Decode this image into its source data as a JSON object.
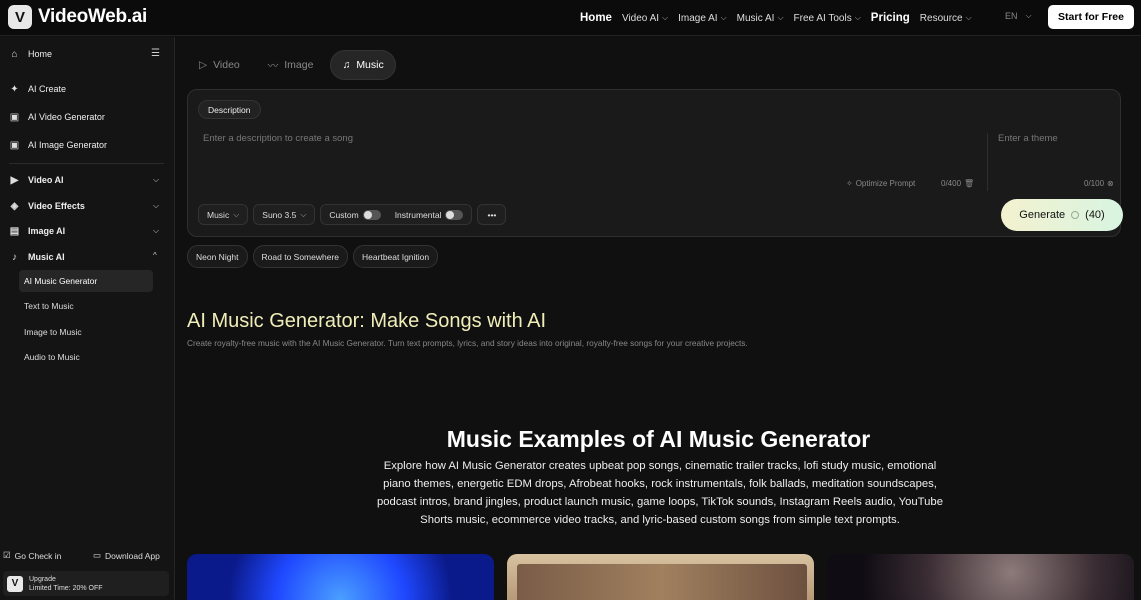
{
  "brand": {
    "name": "VideoWeb.ai",
    "mark": "V"
  },
  "nav": {
    "home": "Home",
    "video_ai": "Video AI",
    "image_ai": "Image AI",
    "music_ai": "Music AI",
    "free_ai_tools": "Free AI Tools",
    "pricing": "Pricing",
    "resource": "Resource",
    "lang": "EN",
    "cta": "Start for Free"
  },
  "sidebar": {
    "home": "Home",
    "ai_create": "AI Create",
    "ai_video_generator": "AI Video Generator",
    "ai_image_generator": "AI Image Generator",
    "video_ai": "Video AI",
    "video_effects": "Video Effects",
    "image_ai": "Image AI",
    "music_ai": "Music AI",
    "music_sub": [
      "AI Music Generator",
      "Text to Music",
      "Image to Music",
      "Audio to Music"
    ],
    "go_check_in": "Go Check in",
    "download_app": "Download App",
    "upgrade": "Upgrade",
    "upgrade_offer": "Limited Time: 20% OFF"
  },
  "tabs": [
    "Video",
    "Image",
    "Music"
  ],
  "panel": {
    "description_label": "Description",
    "description_placeholder": "Enter a description to create a song",
    "optimize_prompt": "Optimize Prompt",
    "desc_count": "0/400",
    "theme_placeholder": "Enter a theme",
    "theme_count": "0/100",
    "model_type": "Music",
    "model_version": "Suno 3.5",
    "custom": "Custom",
    "instrumental": "Instrumental",
    "more": "•••",
    "generate": "Generate",
    "credits": "(40)"
  },
  "suggestions": [
    "Neon Night",
    "Road to Somewhere",
    "Heartbeat Ignition"
  ],
  "hero": {
    "title": "AI Music Generator: Make Songs with AI",
    "subtitle": "Create royalty-free music with the AI Music Generator. Turn text prompts, lyrics, and story ideas into original, royalty-free songs for your creative projects."
  },
  "examples": {
    "title": "Music Examples of AI Music Generator",
    "text": "Explore how AI Music Generator creates upbeat pop songs, cinematic trailer tracks, lofi study music, emotional piano themes, energetic EDM drops, Afrobeat hooks, rock instrumentals, folk ballads, meditation soundscapes, podcast intros, brand jingles, product launch music, game loops, TikTok sounds, Instagram Reels audio, YouTube Shorts music, ecommerce video tracks, and lyric-based custom songs from simple text prompts."
  }
}
